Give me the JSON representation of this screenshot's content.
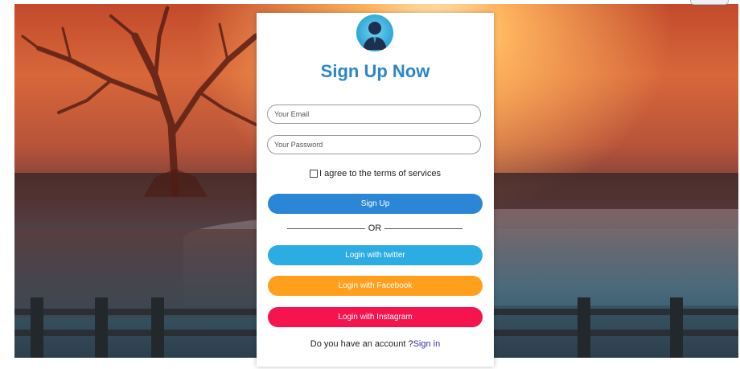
{
  "form": {
    "title": "Sign Up Now",
    "email_placeholder": "Your Email",
    "password_placeholder": "Your Password",
    "agree_label": "I agree to the terms of services",
    "signup_label": "Sign Up",
    "or_label": "OR",
    "twitter_label": "Login with twitter",
    "facebook_label": "Login with Facebook",
    "instagram_label": "Login with Instagram",
    "account_prompt": "Do you have an account ?",
    "signin_link": "Sign in"
  },
  "colors": {
    "title": "#2b86c8",
    "signup": "#2b86d6",
    "twitter": "#2bace2",
    "facebook": "#ff9f1c",
    "instagram": "#f5144e",
    "link": "#3a2fb0"
  },
  "icons": {
    "avatar": "user-avatar-icon"
  }
}
